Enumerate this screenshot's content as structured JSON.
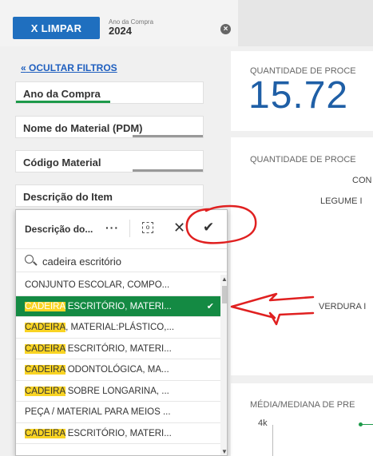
{
  "topbar": {
    "clear_label": "X  LIMPAR",
    "chip_label": "Ano da Compra",
    "chip_value": "2024"
  },
  "filters": {
    "hide_label": "OCULTAR FILTROS",
    "items": [
      {
        "label": "Ano da Compra"
      },
      {
        "label": "Nome do Material (PDM)"
      },
      {
        "label": "Código Material"
      },
      {
        "label": "Descrição do Item"
      }
    ]
  },
  "cards": {
    "kpi_title": "QUANTIDADE DE PROCE",
    "kpi_value": "15.72",
    "chart_title": "QUANTIDADE DE PROCE",
    "chart_labels": [
      "CON",
      "LEGUME I",
      "VERDURA I"
    ],
    "bottom_title": "MÉDIA/MEDIANA DE PRE",
    "bottom_axis_tick": "4k"
  },
  "dropdown": {
    "title": "Descrição do...",
    "more": "···",
    "search_value": "cadeira escritório",
    "items": [
      {
        "pre": "",
        "hl": "",
        "text": "CONJUNTO ESCOLAR, COMPO..."
      },
      {
        "pre": "",
        "hl": "CADEIRA",
        "text": " ESCRITÓRIO, MATERI..."
      },
      {
        "pre": "",
        "hl": "CADEIRA",
        "text": ", MATERIAL:PLÁSTICO,..."
      },
      {
        "pre": "",
        "hl": "CADEIRA",
        "text": " ESCRITÓRIO, MATERI..."
      },
      {
        "pre": "",
        "hl": "CADEIRA",
        "text": " ODONTOLÓGICA, MA..."
      },
      {
        "pre": "",
        "hl": "CADEIRA",
        "text": " SOBRE LONGARINA, ..."
      },
      {
        "pre": "",
        "hl": "",
        "text": "PEÇA / MATERIAL PARA MEIOS ..."
      },
      {
        "pre": "",
        "hl": "CADEIRA",
        "text": " ESCRITÓRIO, MATERI..."
      },
      {
        "pre": "",
        "hl": "",
        "text": ""
      }
    ]
  },
  "colors": {
    "accent_blue": "#1f6fbf",
    "selected_green": "#148a43",
    "highlight_yellow": "#f9d423",
    "annotation_red": "#e02020"
  }
}
